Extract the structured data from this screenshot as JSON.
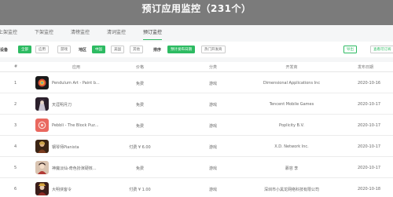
{
  "header": {
    "title": "预订应用监控（231个）"
  },
  "tabs": [
    {
      "label": "上架监控"
    },
    {
      "label": "下架监控"
    },
    {
      "label": "清榜监控"
    },
    {
      "label": "清词监控"
    },
    {
      "label": "预订监控",
      "active": true
    }
  ],
  "filters": {
    "device_label": "设备",
    "device_options": [
      "全部",
      "应用",
      "游戏"
    ],
    "region_label": "地区",
    "region_options": [
      "中国",
      "美国",
      "其他"
    ],
    "sort_label": "排序",
    "sort_options": [
      "预计发布日期",
      "热门开发商"
    ],
    "export_label": "导出",
    "view_label": "查看可订阅"
  },
  "table": {
    "headers": [
      "#",
      "应用",
      "价格",
      "分类",
      "开发商",
      "发布日期"
    ],
    "rows": [
      {
        "index": "1",
        "icon": "pendulum-art-icon",
        "name": "Pendulum Art - Paint b...",
        "price": "免费",
        "category": "游戏",
        "developer": "Dimensional Applications Inc",
        "date": "2020-10-16"
      },
      {
        "index": "2",
        "icon": "game-character-icon",
        "name": "天涯明月刀",
        "price": "免费",
        "category": "游戏",
        "developer": "Tencent Mobile Games",
        "date": "2020-10-17"
      },
      {
        "index": "3",
        "icon": "pebbli-icon",
        "name": "Pebbli - The Block Puz...",
        "price": "免费",
        "category": "游戏",
        "developer": "Poplicity B.V.",
        "date": "2020-10-17"
      },
      {
        "index": "4",
        "icon": "pianista-icon",
        "name": "钢琴师Pianista",
        "price": "付费 ¥ 6.00",
        "category": "游戏",
        "developer": "X.D. Network Inc.",
        "date": "2020-10-17"
      },
      {
        "index": "5",
        "icon": "game-character-icon",
        "name": "神魔淡仙-奇色扮演硬核...",
        "price": "免费",
        "category": "游戏",
        "developer": "慕容 李",
        "date": "2020-10-17"
      },
      {
        "index": "6",
        "icon": "game-character-icon",
        "name": "大明侠客令",
        "price": "付费 ¥ 1.00",
        "category": "游戏",
        "developer": "深圳市小黑龙网络科技有限公司",
        "date": "2020-10-18"
      }
    ]
  },
  "colors": {
    "accent": "#2dbb62",
    "header_bg": "#7b7b7b",
    "pebbli": "#e9685f"
  }
}
